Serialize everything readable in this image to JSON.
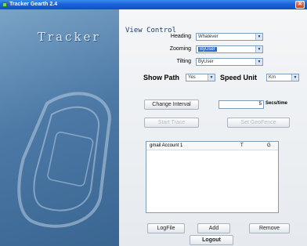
{
  "window": {
    "title": "Tracker Gearth 2.4",
    "close_glyph": "✕"
  },
  "brand": {
    "logo_text": "Tracker"
  },
  "view_control": {
    "title": "View Control",
    "heading": {
      "label": "Heading",
      "value": "Whatever"
    },
    "zooming": {
      "label": "Zooming",
      "value": "ByUser"
    },
    "tilting": {
      "label": "Tilting",
      "value": "ByUser"
    }
  },
  "path_row": {
    "show_path_label": "Show Path",
    "show_path_value": "Yes",
    "speed_unit_label": "Speed Unit",
    "speed_unit_value": "Km"
  },
  "interval": {
    "button_label": "Change Interval",
    "value": "5",
    "unit": "Secs/time"
  },
  "trace": {
    "start_label": "Start Trace",
    "geofence_label": "Set GeoFence"
  },
  "accounts_list": {
    "columns": [
      "gmail Account 1",
      "T",
      "G"
    ]
  },
  "actions": {
    "logfile": "LogFile",
    "add": "Add",
    "remove": "Remove"
  },
  "logout_label": "Logout",
  "icons": {
    "dropdown": "chevron-down-icon",
    "window": "app-icon"
  },
  "colors": {
    "title_bar": "#1d63d8",
    "left_panel": "#4c79a6",
    "selection": "#316ac5"
  }
}
